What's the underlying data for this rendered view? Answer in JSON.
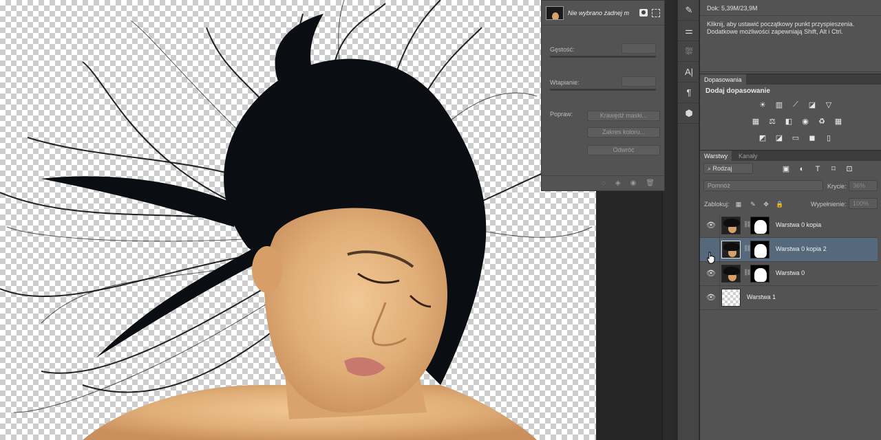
{
  "properties_panel": {
    "header_text": "Nie wybrano żadnej m",
    "density_label": "Gęstość:",
    "feather_label": "Wtapianie:",
    "refine_label": "Popraw:",
    "mask_edge_button": "Krawędź maski...",
    "color_range_button": "Zakres koloru...",
    "invert_button": "Odwróć",
    "footer_icons": [
      "selection-icon",
      "apply-mask-icon",
      "visibility-icon",
      "trash-icon"
    ]
  },
  "info_panel": {
    "doc_size": "Dok: 5,39M/23,9M",
    "hint": "Kliknij, aby ustawić początkowy punkt przyspieszenia. Dodatkowe możliwości zapewniają Shift, Alt i Ctrl."
  },
  "tools": [
    "brush-icon",
    "sliders-icon",
    "stamp-icon",
    "character-icon",
    "paragraph-icon",
    "3d-cube-icon"
  ],
  "tool_glyphs": [
    "✎",
    "⚌",
    "⛆",
    "A|",
    "¶",
    "⬢"
  ],
  "adjustments": {
    "tab": "Dopasowania",
    "title": "Dodaj dopasowanie",
    "row1": [
      "☀",
      "▥",
      "⟋",
      "◪",
      "▽"
    ],
    "row2": [
      "▦",
      "⚖",
      "◧",
      "◉",
      "♻",
      "▦"
    ],
    "row3": [
      "◩",
      "◪",
      "▭",
      "◼",
      "▯"
    ]
  },
  "layers_panel": {
    "tab_layers": "Warstwy",
    "tab_channels": "Kanały",
    "filter_kind": "⌕ Rodzaj",
    "blend_mode": "Pomnóż",
    "opacity_label": "Krycie:",
    "opacity_value": "36%",
    "lock_label": "Zablokuj:",
    "fill_label": "Wypełnienie:",
    "fill_value": "100%",
    "layers": [
      {
        "name": "Warstwa 0 kopia",
        "visible": true,
        "selected": false
      },
      {
        "name": "Warstwa 0 kopia 2",
        "visible": false,
        "selected": true
      },
      {
        "name": "Warstwa 0",
        "visible": true,
        "selected": false
      },
      {
        "name": "Warstwa 1",
        "visible": true,
        "selected": false
      }
    ]
  },
  "colors": {
    "panel": "#535353",
    "selected_layer": "#56687c",
    "hair": "#0a0d12",
    "skin": "#e2b07a"
  }
}
